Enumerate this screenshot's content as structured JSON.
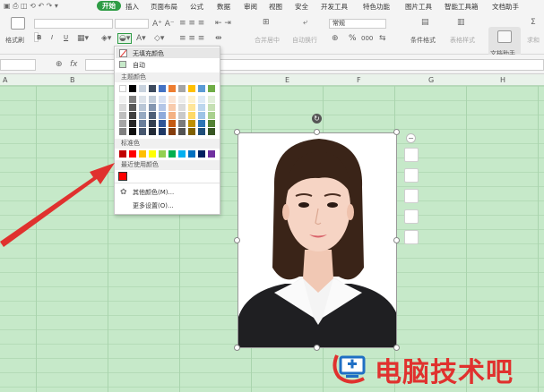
{
  "menu": {
    "start": "开始",
    "items": [
      "插入",
      "页面布局",
      "公式",
      "数据",
      "审阅",
      "视图",
      "安全",
      "开发工具",
      "特色功能",
      "图片工具",
      "智能工具箱",
      "文档助手"
    ]
  },
  "ribbon": {
    "format_painter": "格式刷",
    "bold": "B",
    "italic": "I",
    "underline": "U",
    "merge_center": "合并居中",
    "auto_wrap": "自动换行",
    "number_format": "常规",
    "percent": "%",
    "thousands": "000",
    "conditional_format": "条件格式",
    "table_style": "表格样式",
    "doc_assist": "文档助手",
    "sum": "求和"
  },
  "columns": [
    "A",
    "B",
    "C",
    "D",
    "E",
    "F",
    "G",
    "H"
  ],
  "fill_menu": {
    "no_fill": "无填充颜色",
    "auto": "自动",
    "theme_colors": "主题颜色",
    "standard_colors": "标准色",
    "recent_colors": "最近使用颜色",
    "more_colors": "其他颜色(M)...",
    "more_settings": "更多设置(O)...",
    "theme_top_row": [
      "#ffffff",
      "#000000",
      "#c8d2de",
      "#3d4a5e",
      "#4472c4",
      "#ed7d31",
      "#a5a5a5",
      "#ffc000",
      "#5b9bd5",
      "#70ad47"
    ],
    "theme_shades": [
      [
        "#f2f2f2",
        "#7f7f7f",
        "#dde3ea",
        "#c3cedb",
        "#d9e2f3",
        "#fbe5d6",
        "#ededed",
        "#fff2cc",
        "#deebf7",
        "#e2efda"
      ],
      [
        "#d9d9d9",
        "#595959",
        "#b9c6d6",
        "#8496b0",
        "#b4c6e7",
        "#f8cbad",
        "#dbdbdb",
        "#ffe699",
        "#bdd7ee",
        "#c6e0b4"
      ],
      [
        "#bfbfbf",
        "#404040",
        "#96a9c1",
        "#4e5f78",
        "#8eaadb",
        "#f4b183",
        "#c9c9c9",
        "#ffd966",
        "#9dc3e6",
        "#a9d08e"
      ],
      [
        "#a6a6a6",
        "#262626",
        "#697e9b",
        "#323e50",
        "#2f5597",
        "#c55a11",
        "#7b7b7b",
        "#bf9000",
        "#2e75b6",
        "#548235"
      ],
      [
        "#808080",
        "#0d0d0d",
        "#46566e",
        "#222a36",
        "#1f3864",
        "#843c0b",
        "#525252",
        "#7f6000",
        "#1f4e79",
        "#375623"
      ]
    ],
    "standard": [
      "#c00000",
      "#ff0000",
      "#ffc000",
      "#ffff00",
      "#92d050",
      "#00b050",
      "#00b0f0",
      "#0070c0",
      "#002060",
      "#7030a0"
    ],
    "recent": [
      "#ff0000"
    ],
    "auto_color": "#c6e9c9"
  },
  "watermark": {
    "text": "电脑技术吧"
  },
  "colors": {
    "accent_green": "#2e9c45",
    "sheet_bg": "#c6e9c9",
    "arrow_red": "#e0312e"
  }
}
